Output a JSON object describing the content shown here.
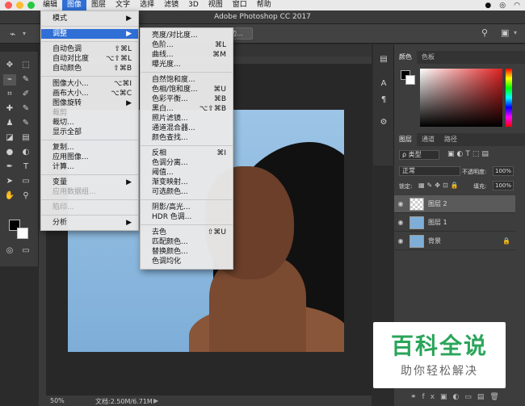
{
  "menubar": {
    "items": [
      "图像",
      "图层",
      "文字",
      "选择",
      "滤镜",
      "3D",
      "视图",
      "窗口",
      "帮助"
    ],
    "app_menus": [
      "编辑"
    ],
    "active": "图像",
    "right_icons": [
      "qq-icon",
      "weibo-icon",
      "wifi-icon"
    ]
  },
  "window": {
    "title": "Adobe Photoshop CC 2017"
  },
  "options": {
    "button_label": "边..."
  },
  "image_menu": {
    "items": [
      {
        "label": "模式",
        "arrow": "▶"
      },
      {
        "sep": true
      },
      {
        "label": "调整",
        "arrow": "▶",
        "highlight": true
      },
      {
        "sep": true
      },
      {
        "label": "自动色调",
        "shortcut": "⇧⌘L"
      },
      {
        "label": "自动对比度",
        "shortcut": "⌥⇧⌘L"
      },
      {
        "label": "自动颜色",
        "shortcut": "⇧⌘B"
      },
      {
        "sep": true
      },
      {
        "label": "图像大小...",
        "shortcut": "⌥⌘I"
      },
      {
        "label": "画布大小...",
        "shortcut": "⌥⌘C"
      },
      {
        "label": "图像旋转",
        "arrow": "▶"
      },
      {
        "label": "裁剪",
        "disabled": true
      },
      {
        "label": "裁切..."
      },
      {
        "label": "显示全部"
      },
      {
        "sep": true
      },
      {
        "label": "复制..."
      },
      {
        "label": "应用图像..."
      },
      {
        "label": "计算..."
      },
      {
        "sep": true
      },
      {
        "label": "变量",
        "arrow": "▶"
      },
      {
        "label": "应用数据组...",
        "disabled": true
      },
      {
        "sep": true
      },
      {
        "label": "陷印...",
        "disabled": true
      },
      {
        "sep": true
      },
      {
        "label": "分析",
        "arrow": "▶"
      }
    ]
  },
  "adjust_menu": {
    "items": [
      {
        "label": "亮度/对比度..."
      },
      {
        "label": "色阶...",
        "shortcut": "⌘L"
      },
      {
        "label": "曲线...",
        "shortcut": "⌘M"
      },
      {
        "label": "曝光度..."
      },
      {
        "sep": true
      },
      {
        "label": "自然饱和度..."
      },
      {
        "label": "色相/饱和度...",
        "shortcut": "⌘U"
      },
      {
        "label": "色彩平衡...",
        "shortcut": "⌘B"
      },
      {
        "label": "黑白...",
        "shortcut": "⌥⇧⌘B"
      },
      {
        "label": "照片滤镜..."
      },
      {
        "label": "通道混合器..."
      },
      {
        "label": "颜色查找..."
      },
      {
        "sep": true
      },
      {
        "label": "反相",
        "shortcut": "⌘I"
      },
      {
        "label": "色调分离..."
      },
      {
        "label": "阈值..."
      },
      {
        "label": "渐变映射..."
      },
      {
        "label": "可选颜色..."
      },
      {
        "sep": true
      },
      {
        "label": "阴影/高光..."
      },
      {
        "label": "HDR 色调..."
      },
      {
        "sep": true
      },
      {
        "label": "去色",
        "shortcut": "⇧⌘U"
      },
      {
        "label": "匹配颜色..."
      },
      {
        "label": "替换颜色..."
      },
      {
        "label": "色调均化"
      }
    ]
  },
  "panels": {
    "color_tabs": [
      "颜色",
      "色板"
    ],
    "layer_tabs": [
      "图层",
      "通道",
      "路径"
    ],
    "kind_filter": "ρ 类型",
    "blend_mode": "正常",
    "opacity_label": "不透明度:",
    "opacity_value": "100%",
    "lock_label": "锁定:",
    "fill_label": "填充:",
    "fill_value": "100%",
    "layers": [
      {
        "name": "图层 2",
        "selected": true
      },
      {
        "name": "图层 1",
        "selected": false
      },
      {
        "name": "背景",
        "selected": false,
        "locked": true
      }
    ]
  },
  "status": {
    "zoom": "50%",
    "doc": "文档:2.50M/6.71M"
  },
  "watermark": {
    "title": "百科全说",
    "subtitle": "助你轻松解决"
  }
}
